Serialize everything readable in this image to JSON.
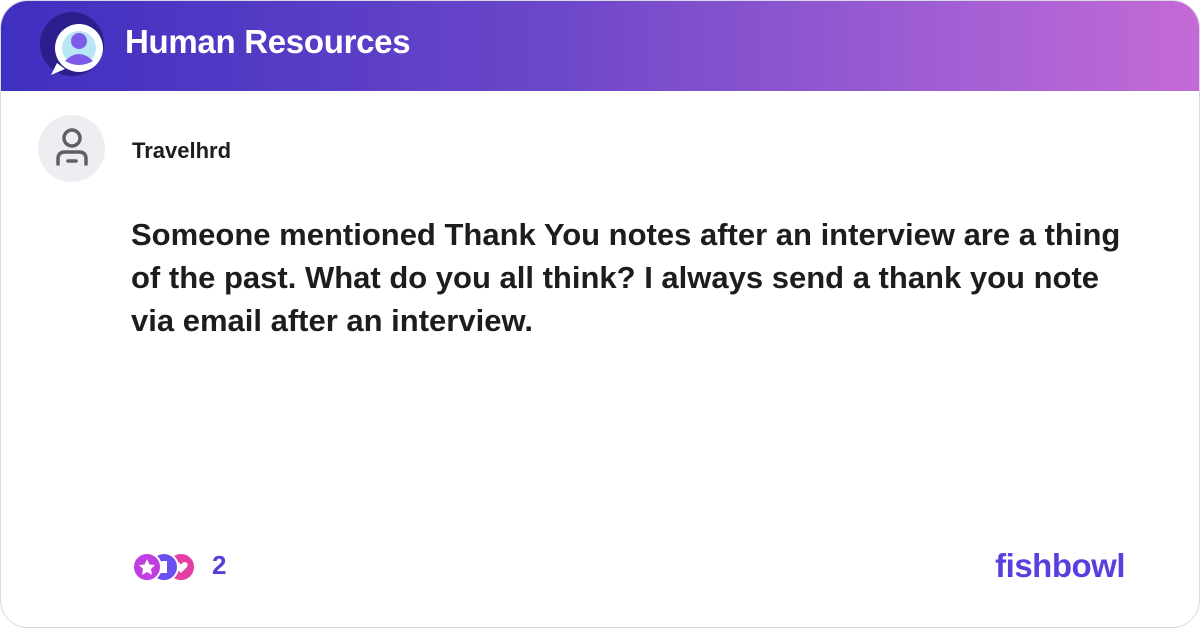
{
  "header": {
    "title": "Human Resources",
    "logo_icon": "bowl-chat-logo-icon",
    "gradient_start": "#3f2fc0",
    "gradient_end": "#c46ad6"
  },
  "post": {
    "author": "Travelhrd",
    "avatar_icon": "person-icon",
    "text": "Someone mentioned Thank You notes after an interview are a thing of the past.  What do you all think? I always send a thank you note via email after an interview."
  },
  "footer": {
    "reaction_icons": [
      "star-reaction-icon",
      "clap-reaction-icon",
      "heart-reaction-icon"
    ],
    "reaction_count": "2",
    "brand": "fishbowl",
    "brand_color": "#5b3ee0"
  }
}
